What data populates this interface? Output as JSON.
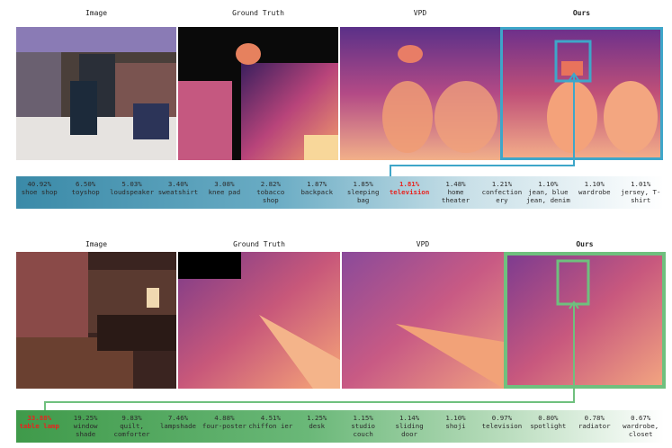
{
  "columns": [
    "Image",
    "Ground Truth",
    "VPD",
    "Ours"
  ],
  "colors": {
    "top_accent": "#3ea6c9",
    "bottom_accent": "#6fc07e",
    "highlight_text": "#e8231f"
  },
  "top_row": {
    "labels": [
      {
        "pct": "40.92%",
        "label": "shoe shop"
      },
      {
        "pct": "6.50%",
        "label": "toyshop"
      },
      {
        "pct": "5.03%",
        "label": "loudspeaker"
      },
      {
        "pct": "3.40%",
        "label": "sweatshirt"
      },
      {
        "pct": "3.08%",
        "label": "knee pad"
      },
      {
        "pct": "2.82%",
        "label": "tobacco shop"
      },
      {
        "pct": "1.87%",
        "label": "backpack"
      },
      {
        "pct": "1.85%",
        "label": "sleeping bag"
      },
      {
        "pct": "1.81%",
        "label": "television"
      },
      {
        "pct": "1.48%",
        "label": "home theater"
      },
      {
        "pct": "1.21%",
        "label": "confection ery"
      },
      {
        "pct": "1.10%",
        "label": "jean, blue jean, denim"
      },
      {
        "pct": "1.10%",
        "label": "wardrobe"
      },
      {
        "pct": "1.01%",
        "label": "jersey, T-shirt"
      }
    ]
  },
  "bottom_row": {
    "labels": [
      {
        "pct": "33.88%",
        "label": "table lamp"
      },
      {
        "pct": "19.25%",
        "label": "window shade"
      },
      {
        "pct": "9.83%",
        "label": "quilt, comforter"
      },
      {
        "pct": "7.46%",
        "label": "lampshade"
      },
      {
        "pct": "4.88%",
        "label": "four-poster"
      },
      {
        "pct": "4.51%",
        "label": "chiffon ier"
      },
      {
        "pct": "1.25%",
        "label": "desk"
      },
      {
        "pct": "1.15%",
        "label": "studio couch"
      },
      {
        "pct": "1.14%",
        "label": "sliding door"
      },
      {
        "pct": "1.10%",
        "label": "shoji"
      },
      {
        "pct": "0.97%",
        "label": "television"
      },
      {
        "pct": "0.80%",
        "label": "spotlight"
      },
      {
        "pct": "0.78%",
        "label": "radiator"
      },
      {
        "pct": "0.67%",
        "label": "wardrobe, closet"
      }
    ]
  }
}
